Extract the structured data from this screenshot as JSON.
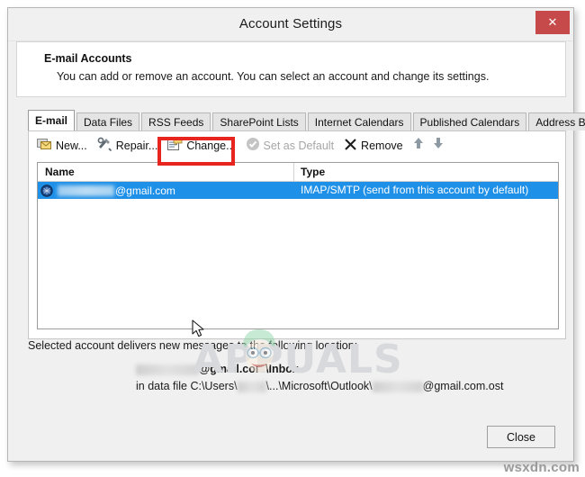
{
  "window": {
    "title": "Account Settings",
    "close_icon": "close-icon",
    "close_label": "✕"
  },
  "header": {
    "title": "E-mail Accounts",
    "description": "You can add or remove an account. You can select an account and change its settings."
  },
  "tabs": [
    {
      "label": "E-mail",
      "active": true
    },
    {
      "label": "Data Files",
      "active": false
    },
    {
      "label": "RSS Feeds",
      "active": false
    },
    {
      "label": "SharePoint Lists",
      "active": false
    },
    {
      "label": "Internet Calendars",
      "active": false
    },
    {
      "label": "Published Calendars",
      "active": false
    },
    {
      "label": "Address Books",
      "active": false
    }
  ],
  "toolbar": {
    "new_label": "New...",
    "repair_label": "Repair...",
    "change_label": "Change...",
    "set_default_label": "Set as Default",
    "remove_label": "Remove",
    "move_up_icon": "arrow-up-icon",
    "move_down_icon": "arrow-down-icon"
  },
  "list": {
    "columns": [
      "Name",
      "Type"
    ],
    "rows": [
      {
        "name_suffix": "@gmail.com",
        "type": "IMAP/SMTP (send from this account by default)",
        "selected": true,
        "icon": "account-globe-icon"
      }
    ]
  },
  "delivery": {
    "intro": "Selected account delivers new messages to the following location:",
    "location_suffix": "@gmail.com\\Inbox",
    "datafile_prefix": "in data file C:\\Users\\",
    "datafile_middle": "\\...\\Microsoft\\Outlook\\",
    "datafile_suffix": "@gmail.com.ost"
  },
  "footer": {
    "close_label": "Close"
  },
  "watermarks": {
    "brand": "APPUALS",
    "site": "wsxdn.com"
  },
  "colors": {
    "selection_blue": "#1e90e8",
    "close_red": "#c74a4a",
    "annotation_red": "#e8241f",
    "dialog_gray": "#f0f0f0"
  }
}
